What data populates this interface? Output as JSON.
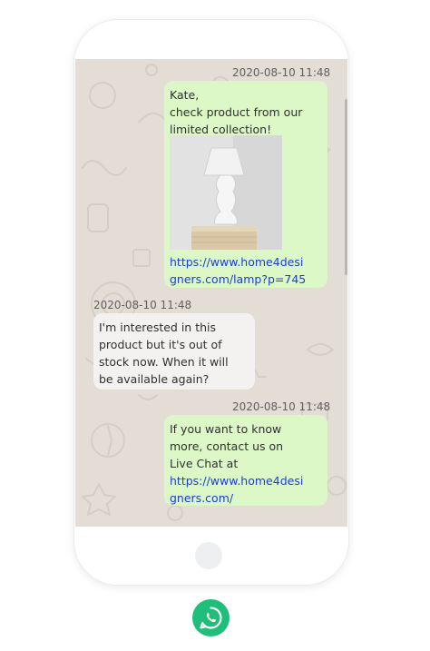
{
  "chat": {
    "messages": [
      {
        "direction": "outgoing",
        "timestamp": "2020-08-10 11:48",
        "text_lines": [
          "Kate,",
          "check product from our",
          "limited collection!"
        ],
        "image": "lamp-product-photo",
        "link_lines": [
          "https://www.home4desi",
          "gners.com/lamp?p=745"
        ]
      },
      {
        "direction": "incoming",
        "timestamp": "2020-08-10 11:48",
        "text_lines": [
          "I'm interested in this",
          "product but it's out of",
          "stock now. When it will",
          "be available again?"
        ]
      },
      {
        "direction": "outgoing",
        "timestamp": "2020-08-10 11:48",
        "text_lines": [
          "If you want to know",
          "more, contact us on",
          "Live Chat at"
        ],
        "link_lines": [
          "https://www.home4desi",
          "gners.com/"
        ]
      }
    ]
  },
  "colors": {
    "outgoing_bubble": "#dcf8c6",
    "incoming_bubble": "#f3f2f1",
    "wallpaper": "#e4ddd6",
    "link": "#1a3ddb",
    "whatsapp_brand": "#1fbe7a"
  },
  "icons": {
    "brand": "whatsapp-icon",
    "home": "home-button"
  }
}
